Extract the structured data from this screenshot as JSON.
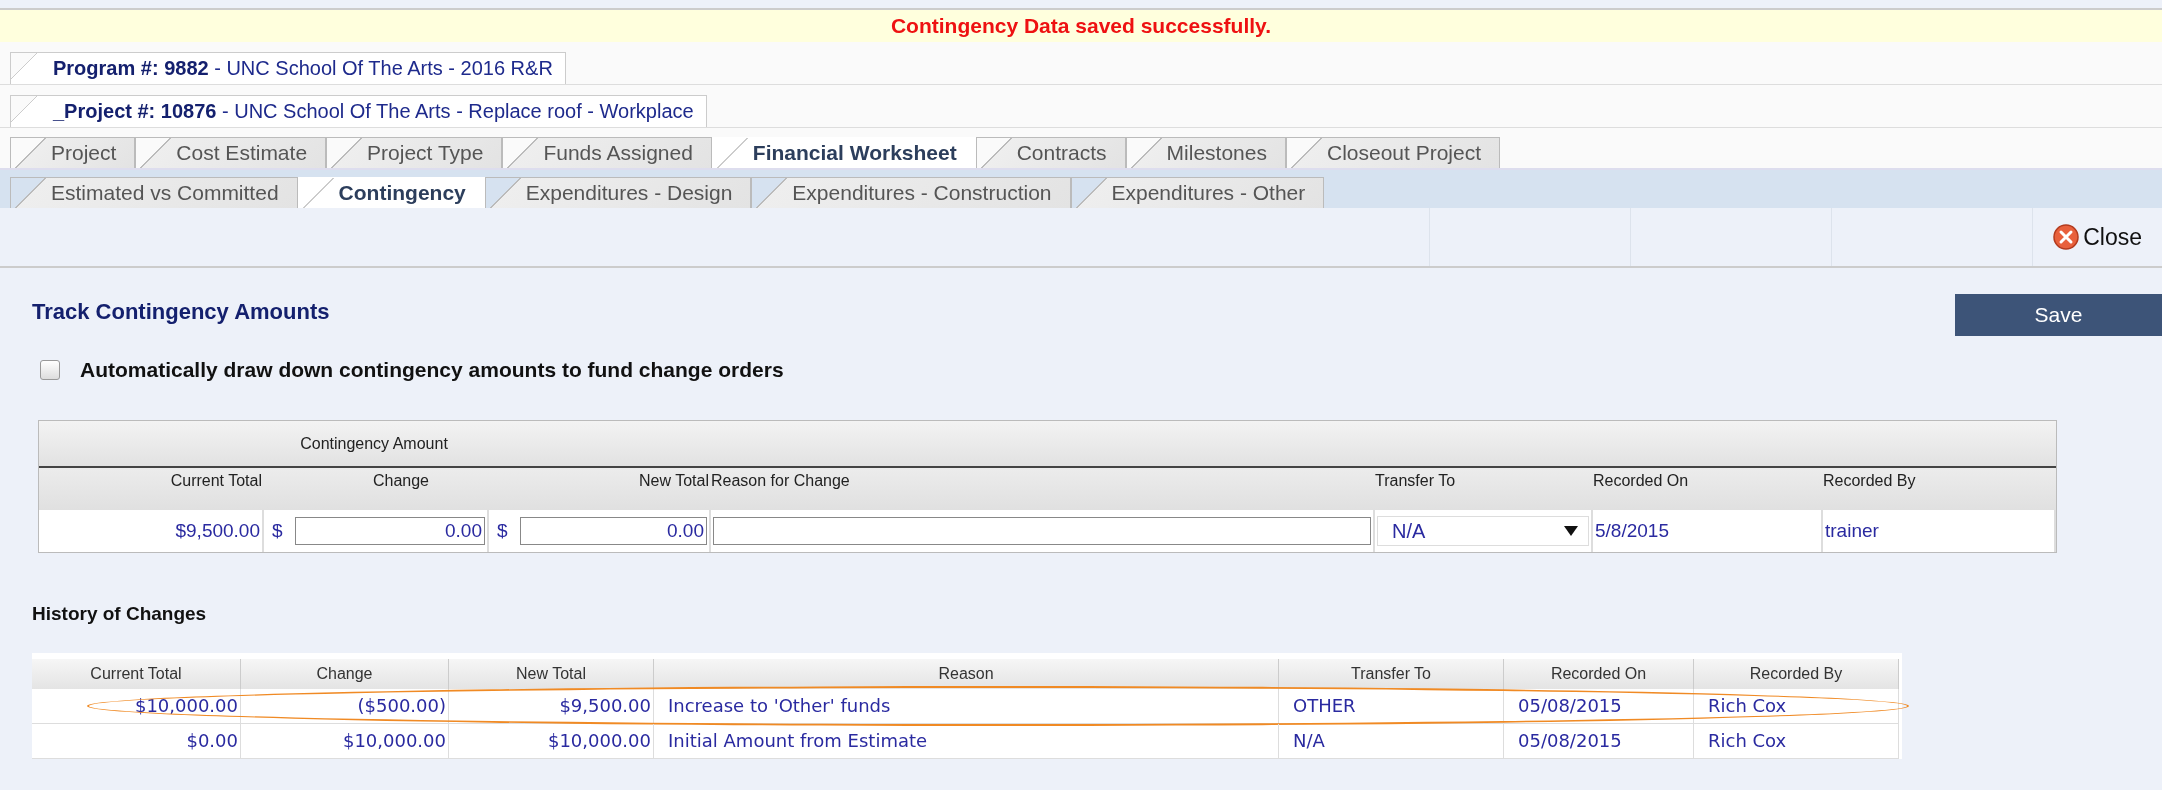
{
  "message": "Contingency Data saved successfully.",
  "breadcrumbs": [
    {
      "text": "**Program #: 9882** - UNC School Of The Arts - 2016 R&R"
    },
    {
      "text": "**_Project #: 10876** - UNC School Of The Arts - Replace roof - Workplace"
    }
  ],
  "tabs": [
    {
      "label": "Project",
      "selected": false
    },
    {
      "label": "Cost Estimate",
      "selected": false
    },
    {
      "label": "Project Type",
      "selected": false
    },
    {
      "label": "Funds Assigned",
      "selected": false
    },
    {
      "label": "Financial Worksheet",
      "selected": true
    },
    {
      "label": "Contracts",
      "selected": false
    },
    {
      "label": "Milestones",
      "selected": false
    },
    {
      "label": "Closeout Project",
      "selected": false
    }
  ],
  "subtabs": [
    {
      "label": "Estimated vs Committed",
      "selected": false
    },
    {
      "label": "Contingency",
      "selected": true
    },
    {
      "label": "Expenditures - Design",
      "selected": false
    },
    {
      "label": "Expenditures - Construction",
      "selected": false
    },
    {
      "label": "Expenditures - Other",
      "selected": false
    }
  ],
  "toolbar": {
    "close": "Close"
  },
  "section_title": "Track Contingency Amounts",
  "save": "Save",
  "auto_draw": {
    "label": "Automatically draw down contingency amounts to fund change orders",
    "checked": false
  },
  "entry": {
    "group_header": "Contingency Amount",
    "columns": [
      "Current Total",
      "Change",
      "New Total",
      "Reason for Change",
      "Transfer To",
      "Recorded On",
      "Recorded By"
    ],
    "current_total": "$9,500.00",
    "change_currency": "$",
    "change": "0.00",
    "new_total_currency": "$",
    "new_total": "0.00",
    "transfer_to": "N/A",
    "recorded_on": "5/8/2015",
    "recorded_by": "trainer"
  },
  "history": {
    "title": "History of Changes",
    "columns": [
      "Current Total",
      "Change",
      "New Total",
      "Reason",
      "Transfer To",
      "Recorded On",
      "Recorded By"
    ],
    "rows": [
      {
        "cells": [
          "$10,000.00",
          "($500.00)",
          "$9,500.00",
          "Increase to 'Other' funds",
          "OTHER",
          "05/08/2015",
          "Rich Cox"
        ],
        "highlighted": true
      },
      {
        "cells": [
          "$0.00",
          "$10,000.00",
          "$10,000.00",
          "Initial Amount from Estimate",
          "N/A",
          "05/08/2015",
          "Rich Cox"
        ],
        "highlighted": false
      }
    ]
  }
}
